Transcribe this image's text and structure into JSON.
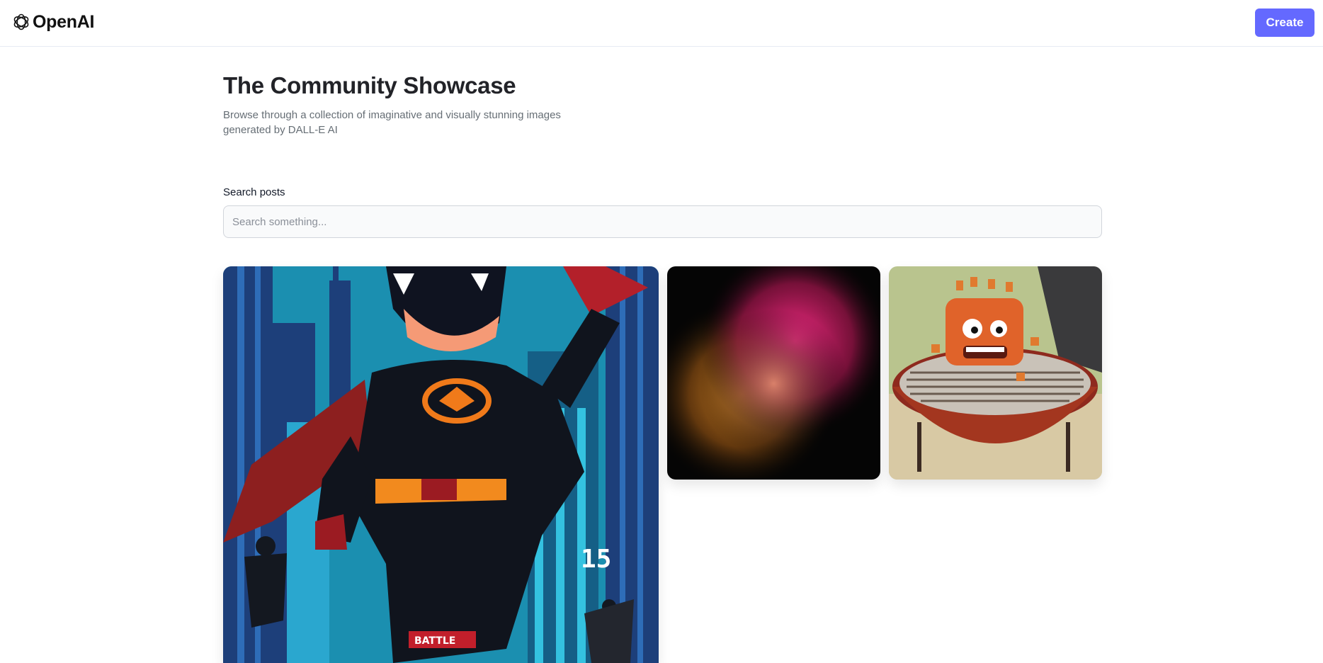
{
  "header": {
    "brand": "OpenAI",
    "create_label": "Create"
  },
  "main": {
    "title": "The Community Showcase",
    "subtitle": "Browse through a collection of imaginative and visually stunning images generated by DALL-E AI",
    "search_label": "Search posts",
    "search_placeholder": "Search something..."
  },
  "gallery": {
    "hero_badge": "BATTLE",
    "hero_sign": "15"
  },
  "colors": {
    "accent": "#6469ff",
    "title": "#222328",
    "subtitle": "#666e75"
  }
}
